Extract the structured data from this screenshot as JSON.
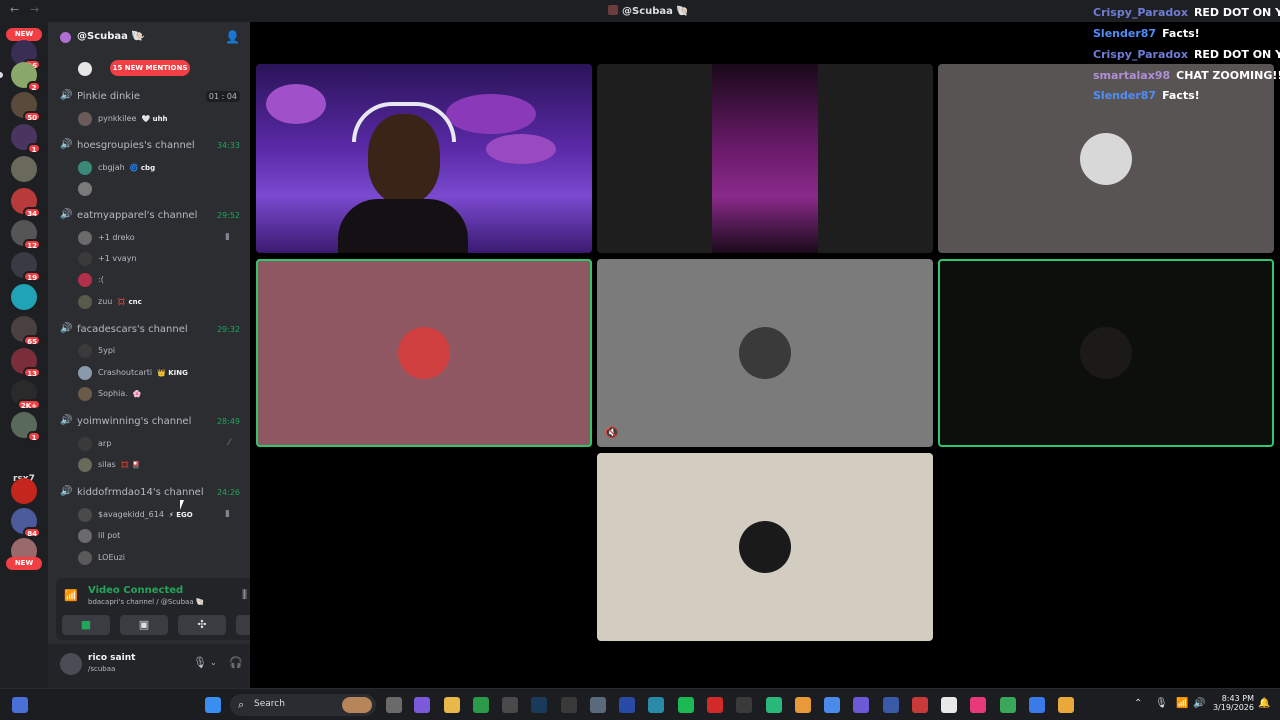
{
  "window": {
    "title": "@Scubaa 🐚"
  },
  "rail": {
    "new_top": "NEW",
    "new_bottom": "NEW",
    "badges": [
      "16",
      "2",
      "50",
      "1",
      "34",
      "12",
      "19",
      "65",
      "13",
      "2K+",
      "1",
      "84"
    ],
    "text_server": "rsx7"
  },
  "sidebar": {
    "server_name": "@Scubaa 🐚",
    "new_mentions": "15 NEW MENTIONS",
    "channels": [
      {
        "name": "Pinkie dinkie",
        "time": "01 : 04",
        "users": [
          {
            "name": "pynkkilee",
            "tag": "🤍 uhh"
          }
        ]
      },
      {
        "name": "hoesgroupies's channel",
        "time": "34:33",
        "users": [
          {
            "name": "cbgjah",
            "tag": "🌀 cbg"
          },
          {
            "name": "",
            "tag": ""
          }
        ]
      },
      {
        "name": "eatmyapparel's channel",
        "time": "29:52",
        "users": [
          {
            "name": "+1 dreko",
            "tag": ""
          },
          {
            "name": "+1 vvayn",
            "tag": ""
          },
          {
            "name": ":(",
            "tag": ""
          },
          {
            "name": "zuu",
            "tag": "💢 cnc"
          }
        ]
      },
      {
        "name": "facadescars's channel",
        "time": "29:32",
        "users": [
          {
            "name": "5ypi",
            "tag": ""
          },
          {
            "name": "Crashoutcarti",
            "tag": "👑 KING"
          },
          {
            "name": "Sophia.",
            "tag": "🌸"
          }
        ]
      },
      {
        "name": "yoimwinning's channel",
        "time": "28:49",
        "users": [
          {
            "name": "arp",
            "tag": ""
          },
          {
            "name": "silas",
            "tag": "💢 🎴"
          }
        ]
      },
      {
        "name": "kiddofrmdao14's channel",
        "time": "24:26",
        "users": [
          {
            "name": "$avagekidd_614",
            "tag": "⚡ EGO"
          },
          {
            "name": "lil pot",
            "tag": ""
          },
          {
            "name": "LOEuzi",
            "tag": ""
          }
        ]
      }
    ]
  },
  "voice": {
    "status": "Video Connected",
    "subtitle": "bdacapri's channel / @Scubaa 🐚"
  },
  "user": {
    "name": "rico saint",
    "status": "/scubaa"
  },
  "chat": [
    {
      "user": "Crispy_Paradox",
      "msg": "RED DOT ON YO",
      "color": "#6f7dd6"
    },
    {
      "user": "Slender87",
      "msg": "Facts!",
      "color": "#4f8ef7"
    },
    {
      "user": "Crispy_Paradox",
      "msg": "RED DOT ON YO",
      "color": "#6f7dd6"
    },
    {
      "user": "smartalax98",
      "msg": "CHAT ZOOMING!!",
      "color": "#b08fd6"
    },
    {
      "user": "Slender87",
      "msg": "Facts!",
      "color": "#4f8ef7"
    }
  ],
  "taskbar": {
    "search": "Search",
    "time": "8:43 PM",
    "date": "3/19/2026"
  },
  "colors": {
    "accent_green": "#23a55a",
    "mention_red": "#f23f43",
    "speaking_outline": "#2dc770"
  }
}
